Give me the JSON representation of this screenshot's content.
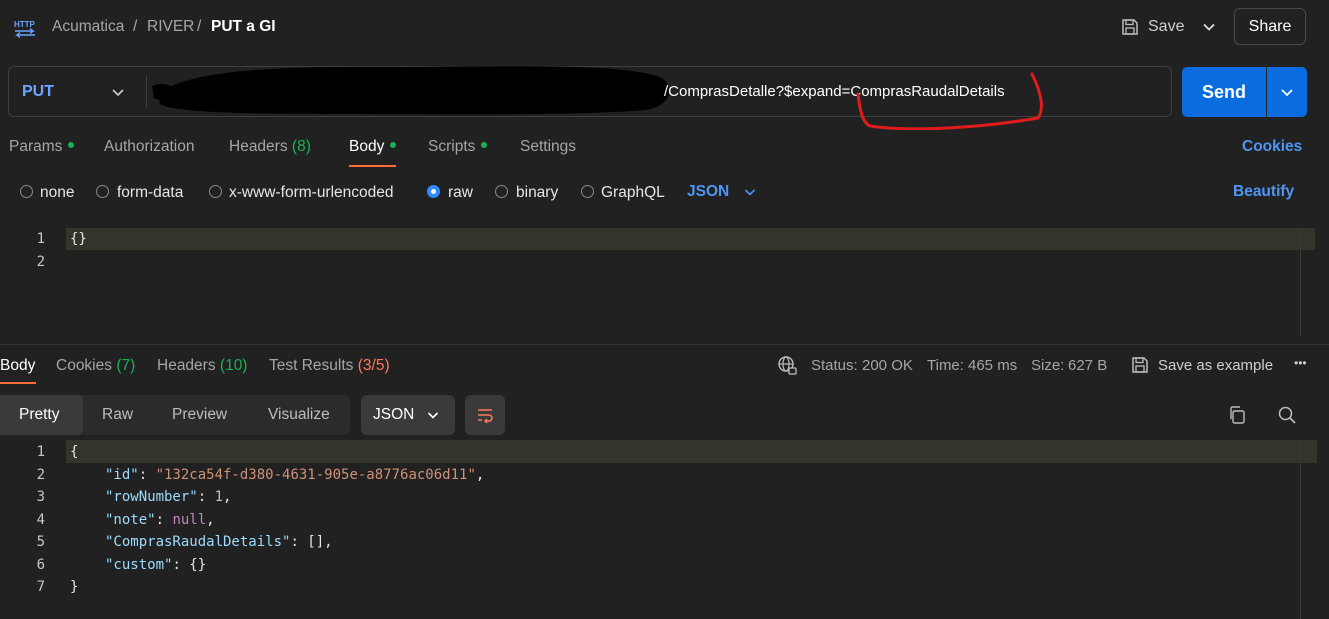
{
  "header": {
    "breadcrumb": [
      "Acumatica",
      "RIVER",
      "PUT a GI"
    ],
    "separator": "/",
    "save_label": "Save",
    "share_label": "Share"
  },
  "request": {
    "method": "PUT",
    "url_visible": "/ComprasDetalle?$expand=ComprasRaudalDetails",
    "send_label": "Send",
    "tabs": [
      {
        "label": "Params",
        "dot": true
      },
      {
        "label": "Authorization"
      },
      {
        "label": "Headers",
        "count": "(8)"
      },
      {
        "label": "Body",
        "dot": true,
        "active": true
      },
      {
        "label": "Scripts",
        "dot": true
      },
      {
        "label": "Settings"
      }
    ],
    "cookies_link": "Cookies",
    "body_types": [
      "none",
      "form-data",
      "x-www-form-urlencoded",
      "raw",
      "binary",
      "GraphQL"
    ],
    "body_type_selected": "raw",
    "language": "JSON",
    "beautify_label": "Beautify",
    "editor_lines": [
      "{}",
      ""
    ]
  },
  "response": {
    "tabs": [
      {
        "label": "Body",
        "active": true
      },
      {
        "label": "Cookies",
        "count": "(7)"
      },
      {
        "label": "Headers",
        "count": "(10)"
      },
      {
        "label": "Test Results",
        "count": "(3/5)"
      }
    ],
    "status_label": "Status:",
    "status_value": "200 OK",
    "time_label": "Time:",
    "time_value": "465 ms",
    "size_label": "Size:",
    "size_value": "627 B",
    "save_example_label": "Save as example",
    "more_label": "•••",
    "formats": [
      "Pretty",
      "Raw",
      "Preview",
      "Visualize"
    ],
    "format_selected": "Pretty",
    "language": "JSON",
    "json": {
      "open": "{",
      "close": "}",
      "id_key": "\"id\"",
      "id_val": "\"132ca54f-d380-4631-905e-a8776ac06d11\"",
      "row_key": "\"rowNumber\"",
      "row_val": "1",
      "note_key": "\"note\"",
      "note_val": "null",
      "details_key": "\"ComprasRaudalDetails\"",
      "details_val": "[]",
      "custom_key": "\"custom\"",
      "custom_val": "{}"
    }
  },
  "colors": {
    "background": "#212121",
    "accent_blue": "#0b6cdf",
    "link_blue": "#4e96f5",
    "success_green": "#19b253",
    "tab_orange": "#ff6c37",
    "annotation_red": "#e01b1b"
  },
  "icons": [
    "http-icon",
    "save-icon",
    "chevron-down-icon",
    "globe-lock-icon",
    "wrap-icon",
    "copy-icon",
    "search-icon"
  ]
}
